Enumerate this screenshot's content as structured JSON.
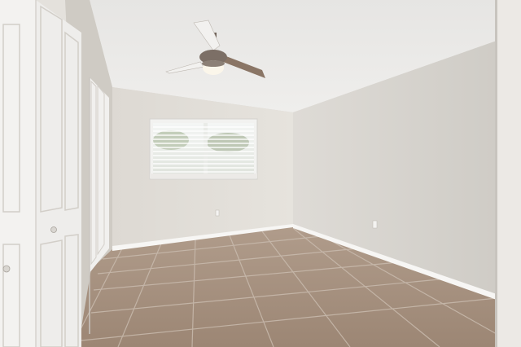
{
  "scene": {
    "subject": "empty bedroom",
    "elements": [
      "ceiling-fan",
      "window-with-blinds",
      "closet-doors",
      "tile-floor",
      "baseboards",
      "wall-outlets"
    ],
    "colors": {
      "ceiling": "#ebeae8",
      "back_wall": "#e2ded8",
      "right_wall": "#dcd9d3",
      "left_wall": "#d2cec8",
      "floor": "#a58f7c",
      "grout": "#cdbfb2",
      "door": "#f4f3f1",
      "baseboard": "#f7f6f4",
      "fan_blade": "#8a7565",
      "fan_light": "#fbf6ea"
    }
  }
}
